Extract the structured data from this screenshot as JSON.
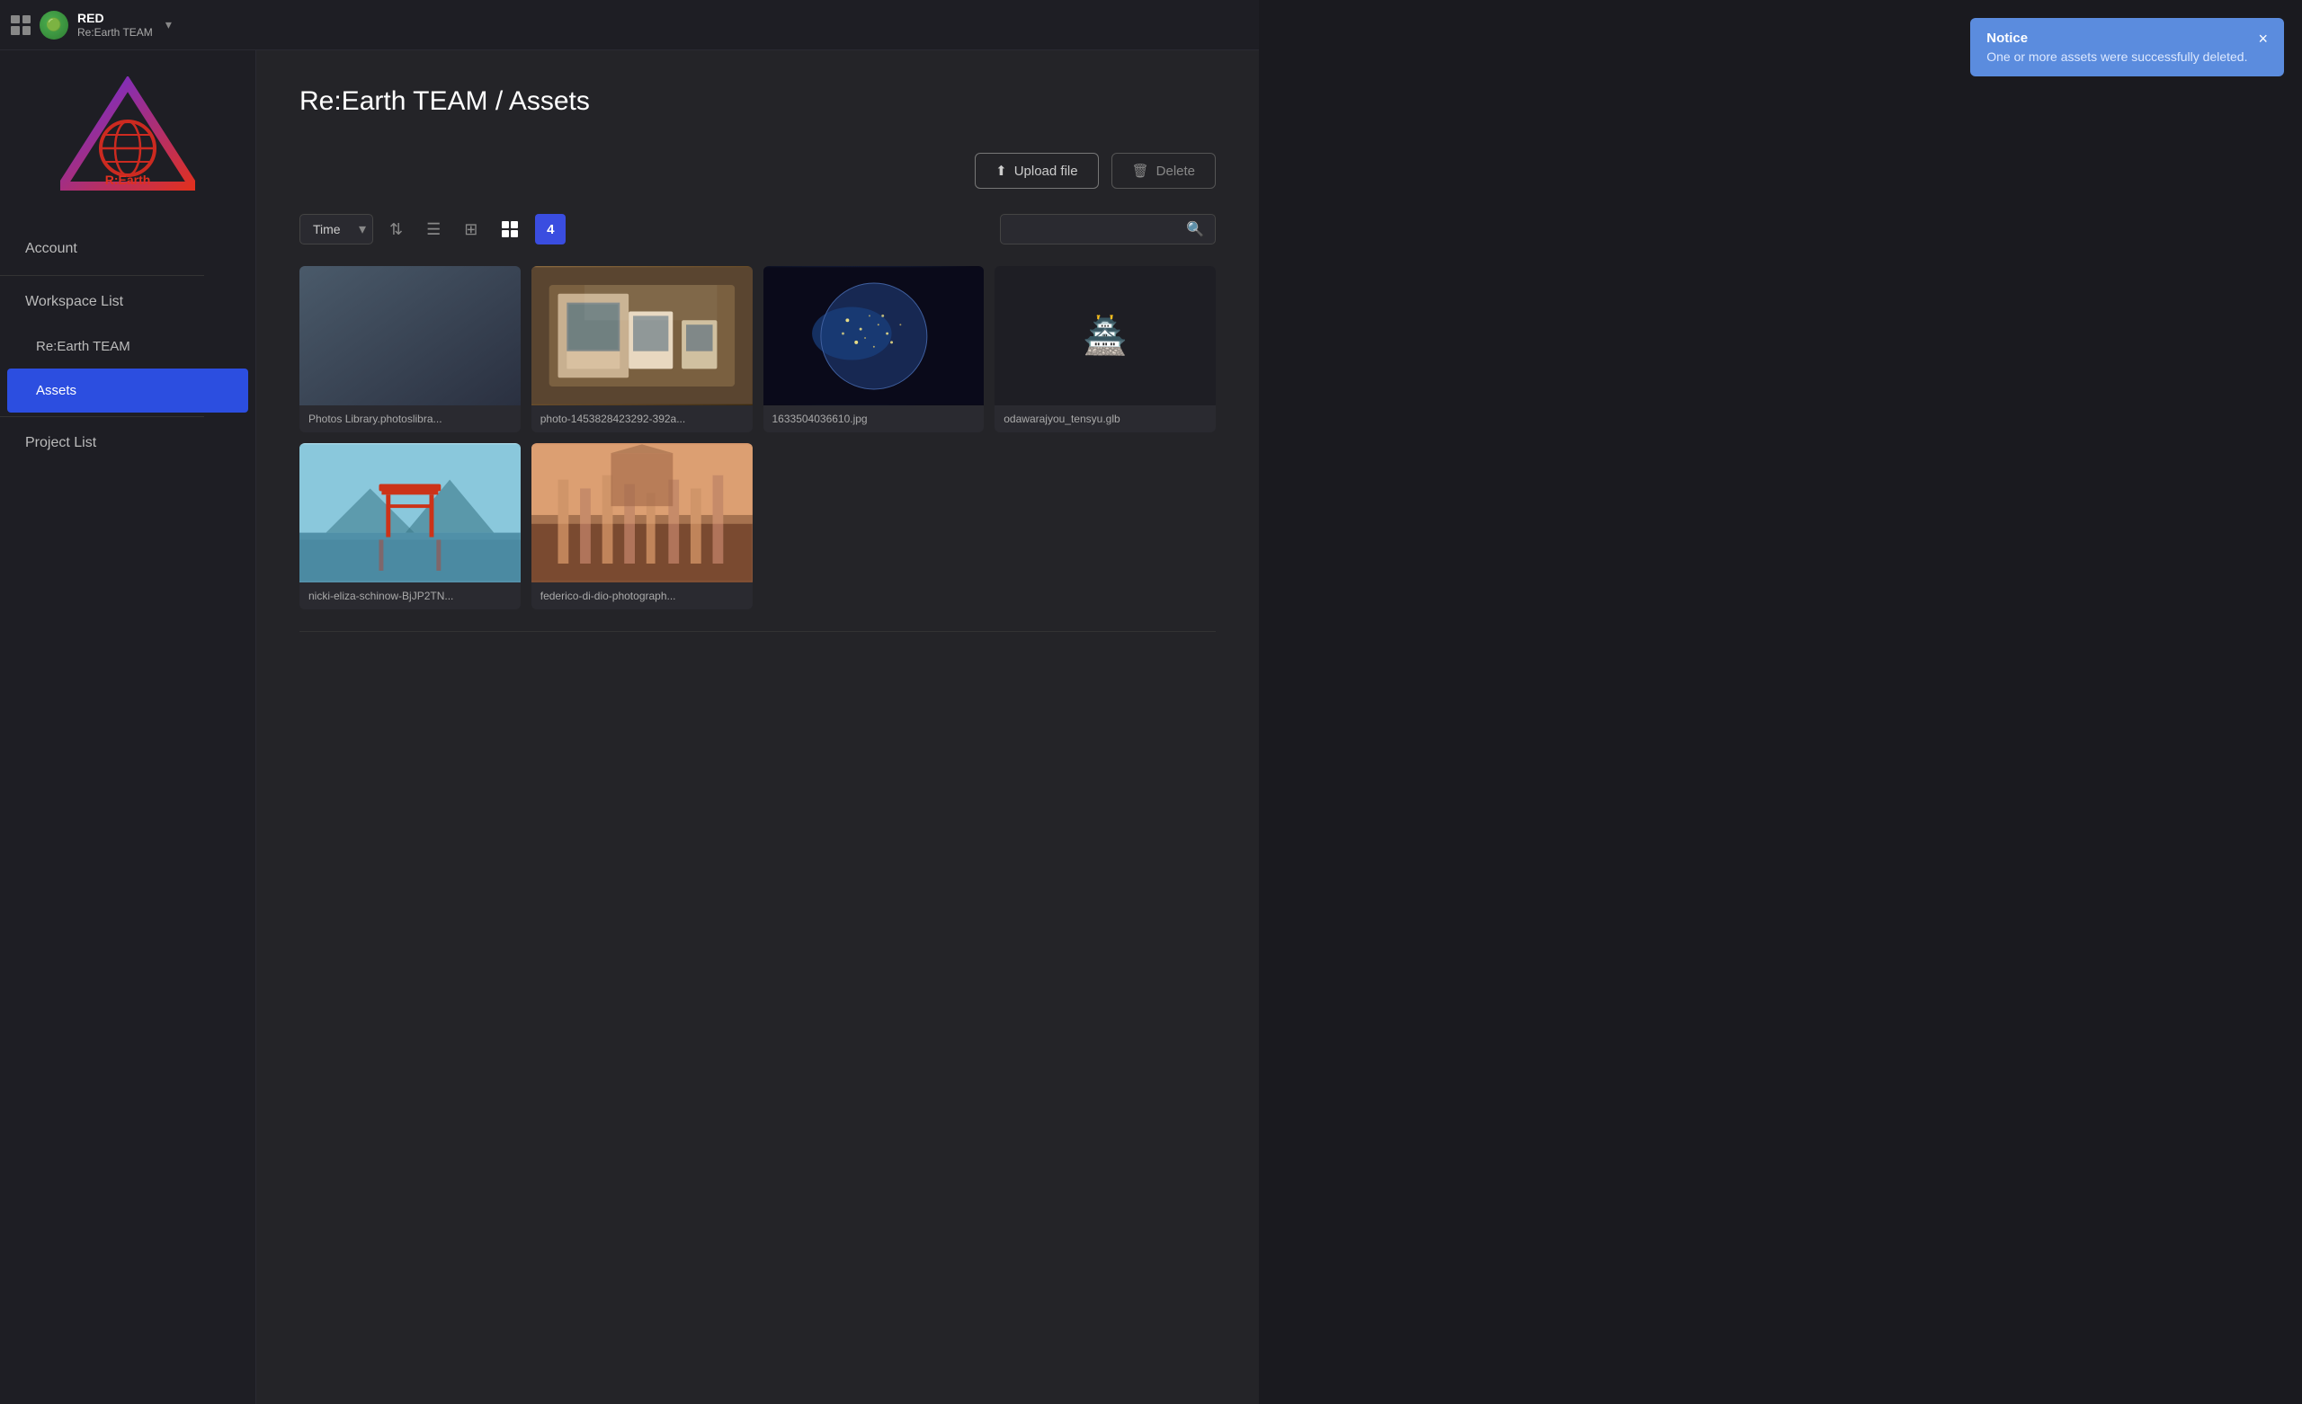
{
  "app": {
    "name": "RED",
    "team": "Re:Earth TEAM"
  },
  "topbar": {
    "name": "RED",
    "team_label": "Re:Earth TEAM"
  },
  "sidebar": {
    "account_label": "Account",
    "workspace_label": "Workspace List",
    "team_label": "Re:Earth TEAM",
    "assets_label": "Assets",
    "project_label": "Project List"
  },
  "header": {
    "breadcrumb": "Re:Earth TEAM / Assets"
  },
  "toolbar": {
    "upload_label": "Upload file",
    "delete_label": "Delete",
    "sort_label": "Time",
    "badge_count": "4",
    "search_placeholder": ""
  },
  "notice": {
    "title": "Notice",
    "message": "One or more assets were successfully deleted.",
    "close": "×"
  },
  "assets": [
    {
      "id": "1",
      "name": "Photos Library.photoslibra...",
      "has_thumb": false,
      "thumb_class": "asset-thumb-placeholder img-photos"
    },
    {
      "id": "2",
      "name": "photo-1453828423292-392a...",
      "has_thumb": true,
      "thumb_class": "asset-thumb img-vintage"
    },
    {
      "id": "3",
      "name": "1633504036610.jpg",
      "has_thumb": true,
      "thumb_class": "asset-thumb img-earth"
    },
    {
      "id": "4",
      "name": "odawarajyou_tensyu.glb",
      "has_thumb": false,
      "thumb_class": "asset-thumb-placeholder"
    },
    {
      "id": "5",
      "name": "nicki-eliza-schinow-BjJP2TN...",
      "has_thumb": true,
      "thumb_class": "asset-thumb img-torii"
    },
    {
      "id": "6",
      "name": "federico-di-dio-photograph...",
      "has_thumb": true,
      "thumb_class": "asset-thumb img-ruins"
    }
  ]
}
